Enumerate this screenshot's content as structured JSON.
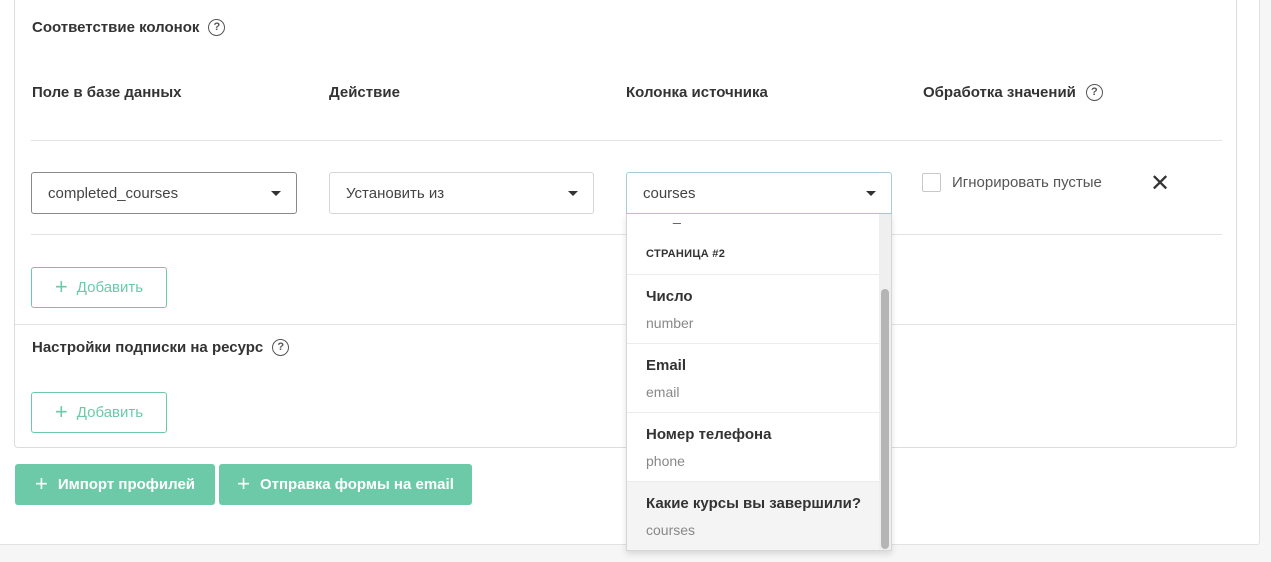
{
  "mapping_section": {
    "title": "Соответствие колонок",
    "columns": {
      "db_field": "Поле в базе данных",
      "action": "Действие",
      "source_column": "Колонка источника",
      "value_processing": "Обработка значений"
    },
    "row": {
      "db_field_value": "completed_courses",
      "action_value": "Установить из",
      "source_value": "courses",
      "ignore_empty_label": "Игнорировать пустые"
    },
    "add_label": "Добавить"
  },
  "subscription_section": {
    "title": "Настройки подписки на ресурс",
    "add_label": "Добавить"
  },
  "footer_buttons": {
    "import_profiles": "Импорт профилей",
    "send_form_email": "Отправка формы на email"
  },
  "dropdown": {
    "partial_item": "_",
    "group_label": "СТРАНИЦА #2",
    "options": [
      {
        "label": "Число",
        "value": "number"
      },
      {
        "label": "Email",
        "value": "email"
      },
      {
        "label": "Номер телефона",
        "value": "phone"
      },
      {
        "label": "Какие курсы вы завершили?",
        "value": "courses",
        "selected": true
      }
    ]
  },
  "icons": {
    "help": "help-circle-icon",
    "caret": "caret-down-icon",
    "close": "close-icon",
    "plus": "plus-icon"
  },
  "colors": {
    "accent": "#6ccaa9",
    "text": "#333333",
    "border": "#dcdcdc"
  }
}
